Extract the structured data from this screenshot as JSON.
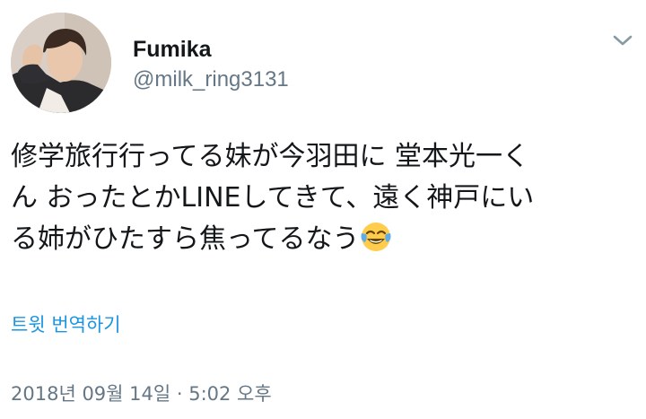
{
  "tweet": {
    "author": {
      "display_name": "Fumika",
      "handle": "@milk_ring3131",
      "avatar_icon": "profile-photo"
    },
    "menu_icon": "chevron-down-icon",
    "text_lines": [
      "修学旅行行ってる妹が今羽田に 堂本光一く",
      "ん おったとかLINEしてきて、遠く神戸にい",
      "る姉がひたすら焦ってるなう"
    ],
    "emoji": "😂",
    "emoji_icon": "face-with-tears-of-joy-icon",
    "translate_label": "트윗 번역하기",
    "timestamp": "2018년 09월 14일 · 5:02 오후"
  },
  "colors": {
    "text": "#14171a",
    "secondary": "#657786",
    "link": "#1b95e0",
    "background": "#ffffff"
  }
}
